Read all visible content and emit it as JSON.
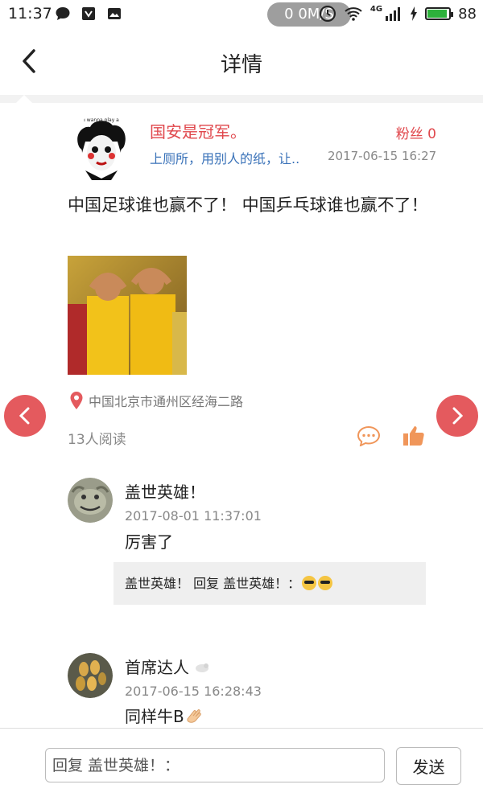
{
  "status_bar": {
    "time": "11:37",
    "network_speed": "0 0M/S",
    "network_type": "4G",
    "battery": "88",
    "battery_level": 0.88
  },
  "header": {
    "title": "详情"
  },
  "post": {
    "author": "国安是冠军。",
    "fans": "粉丝 0",
    "signature": "上厕所，用别人的纸，让..",
    "time": "2017-06-15 16:27",
    "content": "中国足球谁也赢不了！ 中国乒乓球谁也赢不了！",
    "avatar_caption": "I wanna play a",
    "location": "中国北京市通州区经海二路",
    "read_count": "13人阅读"
  },
  "comments": [
    {
      "name": "盖世英雄！",
      "time": "2017-08-01 11:37:01",
      "text": "厉害了",
      "reply": "盖世英雄！ 回复 盖世英雄！："
    },
    {
      "name": "首席达人",
      "time": "2017-06-15 16:28:43",
      "text": "同样牛B"
    }
  ],
  "reply_bar": {
    "placeholder": "回复 盖世英雄！：",
    "send_label": "发送"
  },
  "colors": {
    "accent_red": "#e0474c",
    "nav_red": "#e45a5e",
    "link_blue": "#3b73b9",
    "icon_orange": "#f0965a"
  }
}
